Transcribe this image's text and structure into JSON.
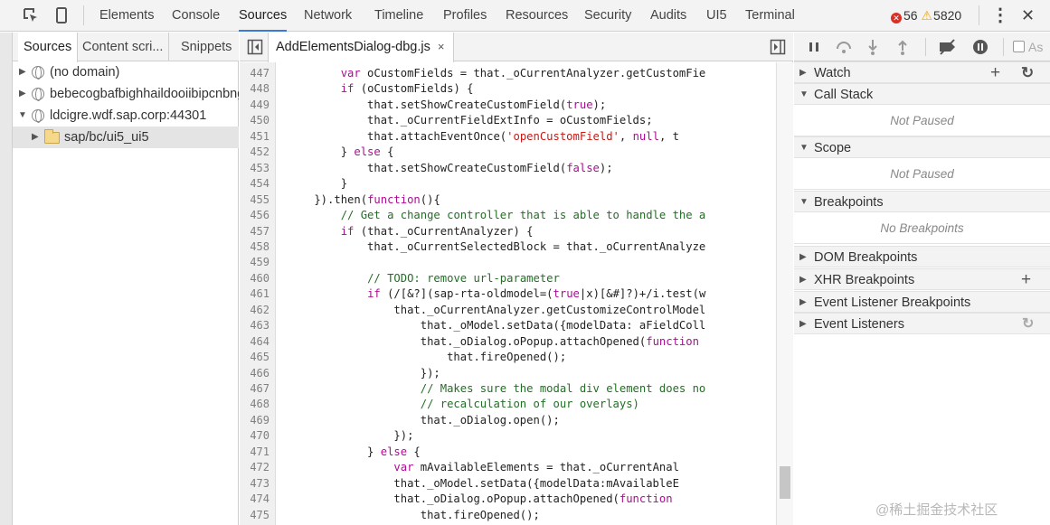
{
  "toolbar": {
    "tabs": [
      "Elements",
      "Console",
      "Sources",
      "Network",
      "Timeline",
      "Profiles",
      "Resources",
      "Security",
      "Audits",
      "UI5",
      "Terminal"
    ],
    "active_tab": "Sources",
    "error_count": "56",
    "warning_count": "5820",
    "error_icon_glyph": "✕",
    "warning_icon_glyph": "⚠",
    "more_glyph": "⋮",
    "close_glyph": "✕"
  },
  "navigator": {
    "tabs": [
      "Sources",
      "Content scri...",
      "Snippets"
    ],
    "tree": [
      {
        "label": "(no domain)",
        "icon": "globe-icon",
        "expanded": false
      },
      {
        "label": "bebecogbafbighhaildooiibipcnbngo",
        "icon": "globe-icon",
        "expanded": false
      },
      {
        "label": "ldcigre.wdf.sap.corp:44301",
        "icon": "globe-icon",
        "expanded": true
      },
      {
        "label": "sap/bc/ui5_ui5",
        "icon": "folder-icon",
        "expanded": false,
        "selected": true
      }
    ]
  },
  "editor": {
    "file_tab": "AddElementsDialog-dbg.js",
    "close_glyph": "×",
    "line_numbers": [
      "447",
      "448",
      "449",
      "450",
      "451",
      "452",
      "453",
      "454",
      "455",
      "456",
      "457",
      "458",
      "459",
      "460",
      "461",
      "462",
      "463",
      "464",
      "465",
      "466",
      "467",
      "468",
      "469",
      "470",
      "471",
      "472",
      "473",
      "474",
      "475"
    ],
    "code_lines": [
      "        var oCustomFields = that._oCurrentAnalyzer.getCustomFie",
      "        if (oCustomFields) {",
      "            that.setShowCreateCustomField(true);",
      "            that._oCurrentFieldExtInfo = oCustomFields;",
      "            that.attachEventOnce('openCustomField', null, t",
      "        } else {",
      "            that.setShowCreateCustomField(false);",
      "        }",
      "    }).then(function(){",
      "        // Get a change controller that is able to handle the a",
      "        if (that._oCurrentAnalyzer) {",
      "            that._oCurrentSelectedBlock = that._oCurrentAnalyze",
      "",
      "            // TODO: remove url-parameter",
      "            if (/[&?](sap-rta-oldmodel=(true|x)[&#]?)+/i.test(w",
      "                that._oCurrentAnalyzer.getCustomizeControlModel",
      "                    that._oModel.setData({modelData: aFieldColl",
      "                    that._oDialog.oPopup.attachOpened(function ",
      "                        that.fireOpened();",
      "                    });",
      "                    // Makes sure the modal div element does no",
      "                    // recalculation of our overlays)",
      "                    that._oDialog.open();",
      "                });",
      "            } else {",
      "                var mAvailableElements = that._oCurrentAnal",
      "                that._oModel.setData({modelData:mAvailableE",
      "                that._oDialog.oPopup.attachOpened(function ",
      "                    that.fireOpened();"
    ]
  },
  "sidebar": {
    "async_label": "As",
    "sections": [
      {
        "title": "Watch",
        "expanded": false,
        "body": null
      },
      {
        "title": "Call Stack",
        "expanded": true,
        "body": "Not Paused"
      },
      {
        "title": "Scope",
        "expanded": true,
        "body": "Not Paused"
      },
      {
        "title": "Breakpoints",
        "expanded": true,
        "body": "No Breakpoints"
      },
      {
        "title": "DOM Breakpoints",
        "expanded": false,
        "body": null
      },
      {
        "title": "XHR Breakpoints",
        "expanded": false,
        "body": null
      },
      {
        "title": "Event Listener Breakpoints",
        "expanded": false,
        "body": null
      },
      {
        "title": "Event Listeners",
        "expanded": false,
        "body": null
      }
    ],
    "add_glyph": "+",
    "refresh_glyph": "↻"
  },
  "watermark": "@稀土掘金技术社区",
  "colors": {
    "accent": "#3879d9",
    "keyword": "#aa0d91",
    "string": "#c41a16",
    "comment": "#236e25",
    "error": "#d93025",
    "warning": "#f2a600"
  }
}
